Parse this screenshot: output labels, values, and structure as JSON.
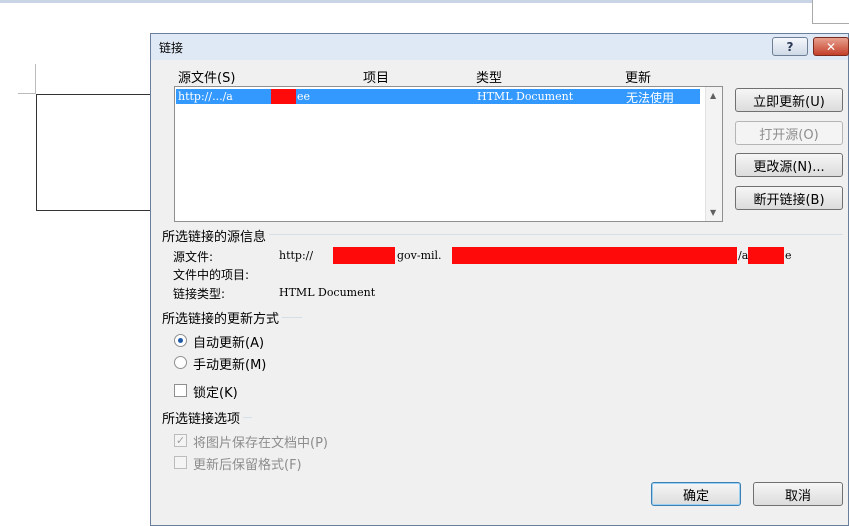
{
  "dialog": {
    "title": "链接",
    "help_glyph": "?",
    "close_glyph": "✕"
  },
  "list": {
    "headers": {
      "source": "源文件(S)",
      "item": "项目",
      "type": "类型",
      "update": "更新"
    },
    "rows": [
      {
        "source": "http://.../a",
        "source_tail": "ee",
        "item": "",
        "type": "HTML Document",
        "update": "无法使用"
      }
    ]
  },
  "buttons": {
    "update_now": "立即更新(U)",
    "open_source": "打开源(O)",
    "change_source": "更改源(N)...",
    "break_link": "断开链接(B)",
    "ok": "确定",
    "cancel": "取消"
  },
  "source_info": {
    "section_title": "所选链接的源信息",
    "source_file_label": "源文件:",
    "item_label": "文件中的项目:",
    "link_type_label": "链接类型:",
    "source_file_prefix": "http://",
    "source_file_mid": "gov-mil.",
    "source_file_tail_a": "/a",
    "source_file_tail_e": "e",
    "item_value": "",
    "link_type_value": "HTML Document"
  },
  "update_method": {
    "section_title": "所选链接的更新方式",
    "auto_label": "自动更新(A)",
    "manual_label": "手动更新(M)",
    "lock_label": "锁定(K)",
    "auto_checked": true,
    "manual_checked": false,
    "lock_checked": false
  },
  "link_options": {
    "section_title": "所选链接选项",
    "save_picture_label": "将图片保存在文档中(P)",
    "keep_format_label": "更新后保留格式(F)",
    "save_picture_checked": true,
    "keep_format_checked": false
  },
  "colors": {
    "selection": "#3399ff",
    "redaction": "#ff0a0a",
    "close_button": "#c4402a"
  }
}
